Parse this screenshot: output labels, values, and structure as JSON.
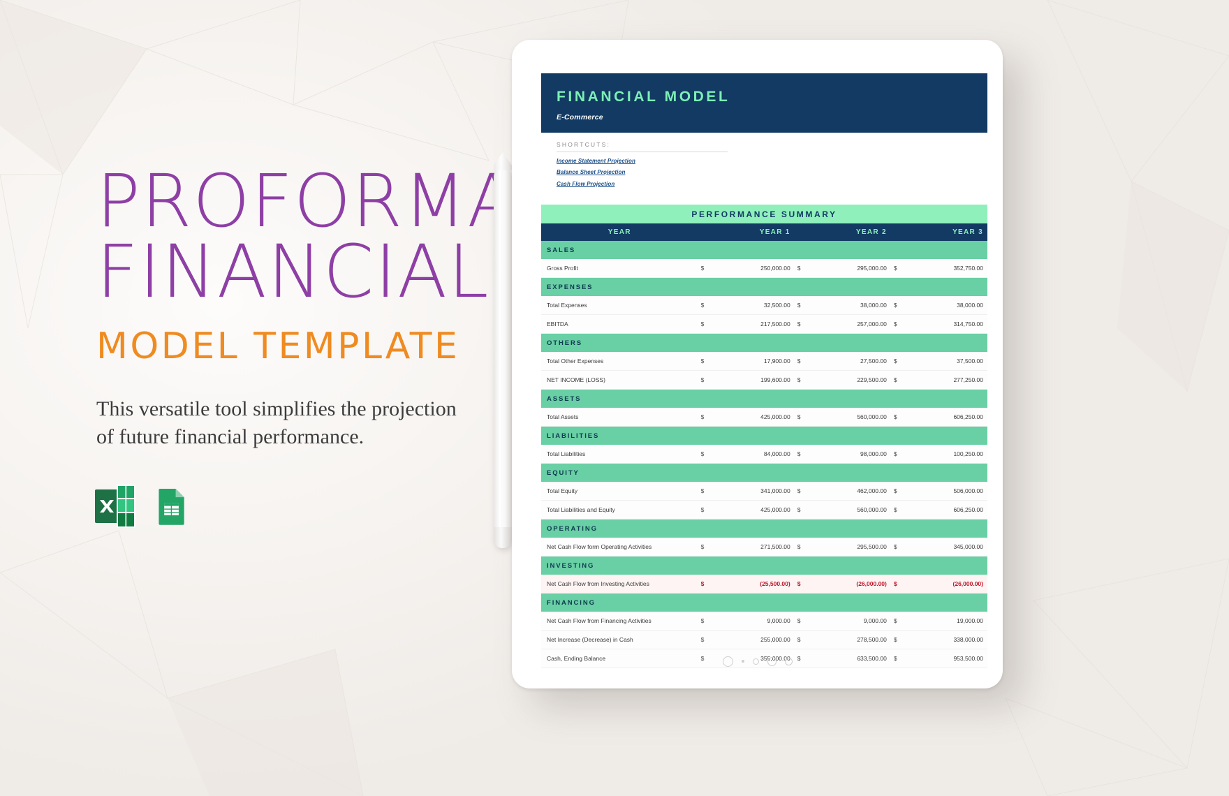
{
  "left_panel": {
    "title_line1": "PROFORMA",
    "title_line2": "FINANCIAL",
    "subtitle": "MODEL TEMPLATE",
    "description": "This versatile tool simplifies the projection of future financial performance.",
    "icons": [
      {
        "name": "microsoft-excel-icon",
        "label": "X",
        "color": "#1d7145"
      },
      {
        "name": "google-sheets-icon",
        "label": "",
        "color": "#23a566"
      }
    ],
    "colors": {
      "title": "#8e3fa5",
      "subtitle": "#ef8b21",
      "body_text": "#3c3c3c"
    }
  },
  "document": {
    "header": {
      "title": "FINANCIAL MODEL",
      "subtitle": "E-Commerce"
    },
    "shortcuts": {
      "label": "SHORTCUTS:",
      "links": [
        "Income Statement Projection",
        "Balance Sheet Projection",
        "Cash Flow Projection"
      ]
    },
    "table": {
      "title": "PERFORMANCE SUMMARY",
      "columns": [
        "YEAR",
        "YEAR 1",
        "YEAR 2",
        "YEAR 3"
      ],
      "currency_symbol": "$",
      "sections": [
        {
          "name": "SALES",
          "rows": [
            {
              "label": "Gross Profit",
              "values": [
                "250,000.00",
                "295,000.00",
                "352,750.00"
              ],
              "negative": false
            }
          ]
        },
        {
          "name": "EXPENSES",
          "rows": [
            {
              "label": "Total Expenses",
              "values": [
                "32,500.00",
                "38,000.00",
                "38,000.00"
              ],
              "negative": false
            },
            {
              "label": "EBITDA",
              "values": [
                "217,500.00",
                "257,000.00",
                "314,750.00"
              ],
              "negative": false
            }
          ]
        },
        {
          "name": "OTHERS",
          "rows": [
            {
              "label": "Total Other Expenses",
              "values": [
                "17,900.00",
                "27,500.00",
                "37,500.00"
              ],
              "negative": false
            },
            {
              "label": "NET INCOME (LOSS)",
              "values": [
                "199,600.00",
                "229,500.00",
                "277,250.00"
              ],
              "negative": false
            }
          ]
        },
        {
          "name": "ASSETS",
          "rows": [
            {
              "label": "Total Assets",
              "values": [
                "425,000.00",
                "560,000.00",
                "606,250.00"
              ],
              "negative": false
            }
          ]
        },
        {
          "name": "LIABILITIES",
          "rows": [
            {
              "label": "Total Liabilities",
              "values": [
                "84,000.00",
                "98,000.00",
                "100,250.00"
              ],
              "negative": false
            }
          ]
        },
        {
          "name": "EQUITY",
          "rows": [
            {
              "label": "Total Equity",
              "values": [
                "341,000.00",
                "462,000.00",
                "506,000.00"
              ],
              "negative": false
            },
            {
              "label": "Total Liabilities and Equity",
              "values": [
                "425,000.00",
                "560,000.00",
                "606,250.00"
              ],
              "negative": false
            }
          ]
        },
        {
          "name": "OPERATING",
          "rows": [
            {
              "label": "Net Cash Flow form Operating Activities",
              "values": [
                "271,500.00",
                "295,500.00",
                "345,000.00"
              ],
              "negative": false
            }
          ]
        },
        {
          "name": "INVESTING",
          "rows": [
            {
              "label": "Net Cash Flow from Investing Activities",
              "values": [
                "(25,500.00)",
                "(26,000.00)",
                "(26,000.00)"
              ],
              "negative": true
            }
          ]
        },
        {
          "name": "FINANCING",
          "rows": [
            {
              "label": "Net Cash Flow from Financing Activities",
              "values": [
                "9,000.00",
                "9,000.00",
                "19,000.00"
              ],
              "negative": false
            },
            {
              "label": "Net Increase (Decrease) in Cash",
              "values": [
                "255,000.00",
                "278,500.00",
                "338,000.00"
              ],
              "negative": false
            },
            {
              "label": "Cash, Ending Balance",
              "values": [
                "355,000.00",
                "633,500.00",
                "953,500.00"
              ],
              "negative": false
            }
          ]
        }
      ]
    },
    "colors": {
      "header_bg": "#123a63",
      "header_title": "#7df0b6",
      "table_title_bg": "#8ff0bc",
      "section_bg": "#69cfa4",
      "negative": "#c0162b"
    }
  }
}
